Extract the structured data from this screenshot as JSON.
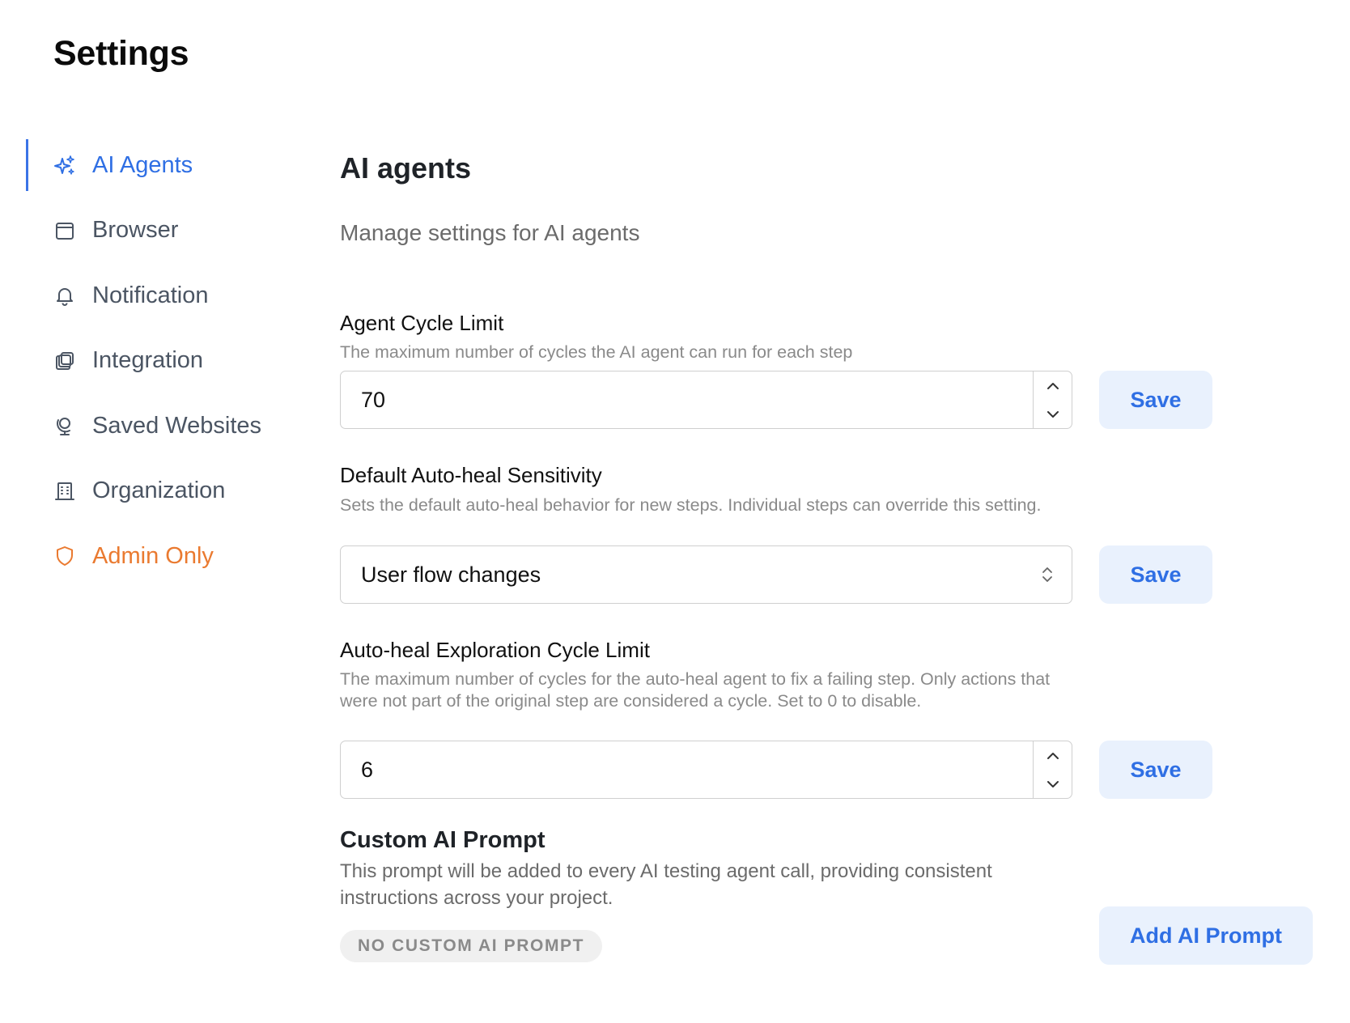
{
  "page": {
    "title": "Settings"
  },
  "sidebar": {
    "items": [
      {
        "label": "AI Agents",
        "icon": "sparkles-icon",
        "active": true
      },
      {
        "label": "Browser",
        "icon": "browser-window-icon"
      },
      {
        "label": "Notification",
        "icon": "bell-icon"
      },
      {
        "label": "Integration",
        "icon": "stacked-squares-icon"
      },
      {
        "label": "Saved Websites",
        "icon": "globe-stand-icon"
      },
      {
        "label": "Organization",
        "icon": "building-icon"
      },
      {
        "label": "Admin Only",
        "icon": "shield-icon"
      }
    ]
  },
  "main": {
    "title": "AI agents",
    "subtitle": "Manage settings for AI agents",
    "agent_cycle_limit": {
      "label": "Agent Cycle Limit",
      "help": "The maximum number of cycles the AI agent can run for each step",
      "value": "70",
      "save_label": "Save"
    },
    "auto_heal_sensitivity": {
      "label": "Default Auto-heal Sensitivity",
      "help": "Sets the default auto-heal behavior for new steps. Individual steps can override this setting.",
      "value": "User flow changes",
      "save_label": "Save"
    },
    "auto_heal_exploration": {
      "label": "Auto-heal Exploration Cycle Limit",
      "help": "The maximum number of cycles for the auto-heal agent to fix a failing step. Only actions that were not part of the original step are considered a cycle. Set to 0 to disable.",
      "value": "6",
      "save_label": "Save"
    },
    "custom_prompt": {
      "title": "Custom AI Prompt",
      "help": "This prompt will be added to every AI testing agent call, providing consistent instructions across your project.",
      "empty_badge": "NO CUSTOM AI PROMPT",
      "add_label": "Add AI Prompt"
    }
  },
  "colors": {
    "accent": "#2f6fe4",
    "admin": "#ea7a30",
    "button_bg": "#e9f1fd"
  }
}
